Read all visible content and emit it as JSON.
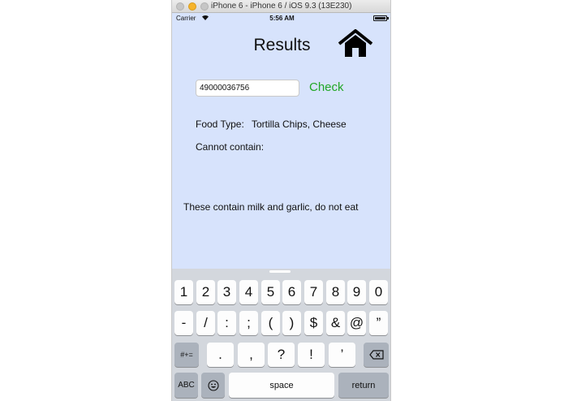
{
  "window": {
    "title": "iPhone 6 - iPhone 6 / iOS 9.3 (13E230)"
  },
  "status_bar": {
    "carrier": "Carrier",
    "time": "5:56 AM"
  },
  "header": {
    "title": "Results"
  },
  "form": {
    "barcode_value": "49000036756",
    "check_label": "Check",
    "check_color": "#22a726"
  },
  "result": {
    "food_type_label": "Food Type:",
    "food_type_value": "Tortilla Chips, Cheese",
    "cannot_contain_label": "Cannot contain:",
    "warning": "These contain milk and garlic, do not eat"
  },
  "keyboard": {
    "row1": [
      "1",
      "2",
      "3",
      "4",
      "5",
      "6",
      "7",
      "8",
      "9",
      "0"
    ],
    "row2": [
      "-",
      "/",
      ":",
      ";",
      "(",
      ")",
      "$",
      "&",
      "@",
      "”"
    ],
    "symbols_label": "#+=",
    "row3": [
      ".",
      ",",
      "?",
      "!",
      "’"
    ],
    "abc_label": "ABC",
    "space_label": "space",
    "return_label": "return"
  },
  "colors": {
    "background": "#d7e3fc",
    "accent": "#22a726",
    "keyboard": "#d3d7dd"
  }
}
